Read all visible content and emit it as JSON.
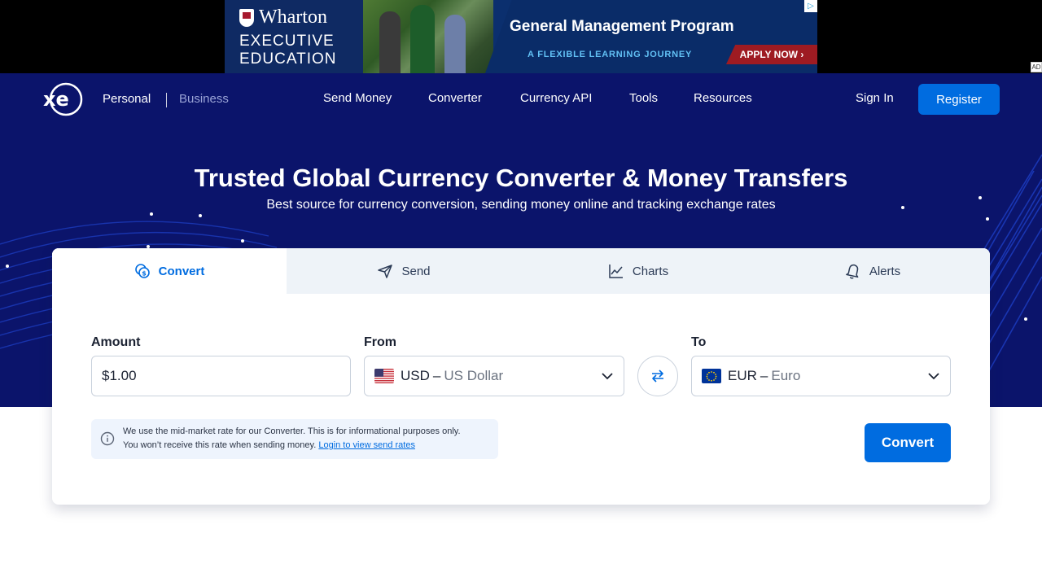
{
  "ad": {
    "brand": "Wharton",
    "line1": "EXECUTIVE",
    "line2": "EDUCATION",
    "headline": "General Management Program",
    "subline": "A FLEXIBLE LEARNING JOURNEY",
    "cta": "APPLY NOW ›",
    "choice_icon": "▷",
    "tag": "AD"
  },
  "nav": {
    "personal": "Personal",
    "business": "Business",
    "links": [
      "Send Money",
      "Converter",
      "Currency API",
      "Tools",
      "Resources"
    ],
    "sign_in": "Sign In",
    "register": "Register"
  },
  "hero": {
    "title": "Trusted Global Currency Converter & Money Transfers",
    "subtitle": "Best source for currency conversion, sending money online and tracking exchange rates"
  },
  "tabs": [
    {
      "label": "Convert",
      "icon": "coins-icon",
      "active": true
    },
    {
      "label": "Send",
      "icon": "paper-plane-icon",
      "active": false
    },
    {
      "label": "Charts",
      "icon": "line-chart-icon",
      "active": false
    },
    {
      "label": "Alerts",
      "icon": "bell-icon",
      "active": false
    }
  ],
  "converter": {
    "amount_label": "Amount",
    "amount_value": "$1.00",
    "from_label": "From",
    "from_code": "USD",
    "from_name": "US Dollar",
    "to_label": "To",
    "to_code": "EUR",
    "to_name": "Euro",
    "separator": "–",
    "convert_button": "Convert"
  },
  "notice": {
    "line1": "We use the mid-market rate for our Converter. This is for informational purposes only.",
    "line2": "You won’t receive this rate when sending money.",
    "link": "Login to view send rates"
  },
  "colors": {
    "hero_bg": "#0b146b",
    "primary": "#006ce0",
    "tab_bg": "#eef3f8"
  }
}
